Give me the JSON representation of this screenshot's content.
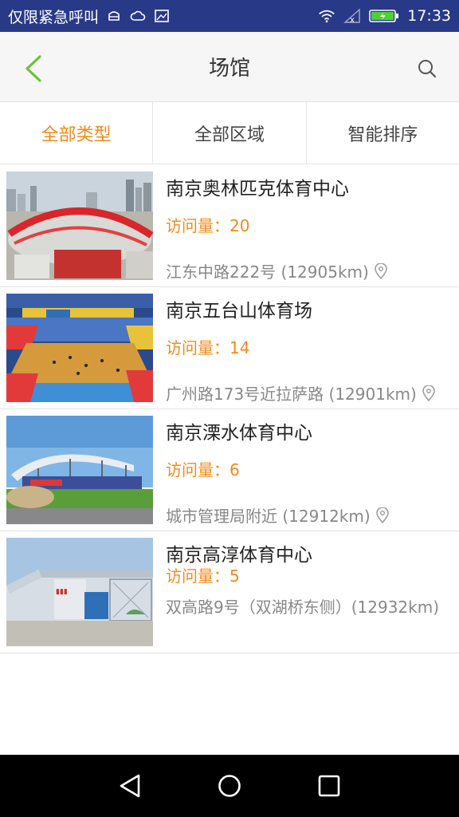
{
  "status_bar": {
    "carrier_text": "仅限紧急呼叫",
    "time": "17:33",
    "icons": [
      "android-debug-icon",
      "cloud-icon",
      "image-icon",
      "wifi-icon",
      "signal-icon",
      "battery-charging-icon"
    ]
  },
  "header": {
    "title": "场馆",
    "back_icon": "chevron-left-icon",
    "search_icon": "search-icon",
    "accent_color": "#6fbf3c"
  },
  "filters": {
    "type_label": "全部类型",
    "region_label": "全部区域",
    "sort_label": "智能排序",
    "active_color": "#f08a1d"
  },
  "venues": [
    {
      "name": "南京奥林匹克体育中心",
      "visits": "访问量：20",
      "address": "江东中路222号 (12905km)"
    },
    {
      "name": "南京五台山体育场",
      "visits": "访问量：14",
      "address": "广州路173号近拉萨路 (12901km)"
    },
    {
      "name": "南京溧水体育中心",
      "visits": "访问量：6",
      "address": "城市管理局附近 (12912km)"
    },
    {
      "name": "南京高淳体育中心",
      "visits": "访问量：5",
      "address": "双高路9号（双湖桥东侧）(12932km)"
    }
  ],
  "nav": {
    "icons": [
      "back-triangle-icon",
      "home-circle-icon",
      "recents-square-icon"
    ]
  }
}
